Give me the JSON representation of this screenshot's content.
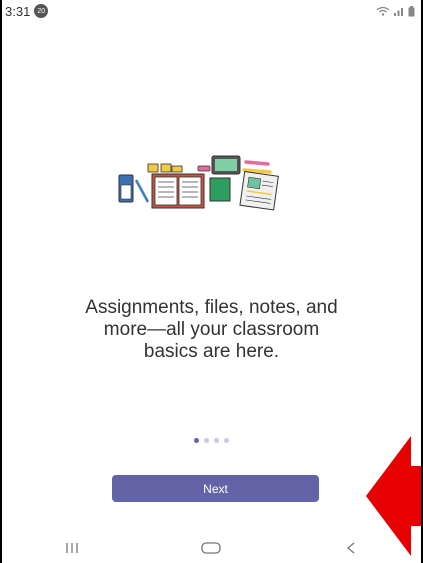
{
  "status_bar": {
    "time": "3:31",
    "notification_badge": "20",
    "signal_text": "…ıl"
  },
  "onboarding": {
    "tagline_lines": [
      "Assignments, files, notes, and",
      "more—all your classroom",
      "basics are here."
    ],
    "page_count": 4,
    "active_page": 1,
    "next_label": "Next"
  },
  "nav_bar": {
    "recents_icon": "recents-icon",
    "home_icon": "home-icon",
    "back_icon": "back-icon"
  },
  "colors": {
    "accent": "#6264a7",
    "annotation_arrow": "#e60000"
  }
}
